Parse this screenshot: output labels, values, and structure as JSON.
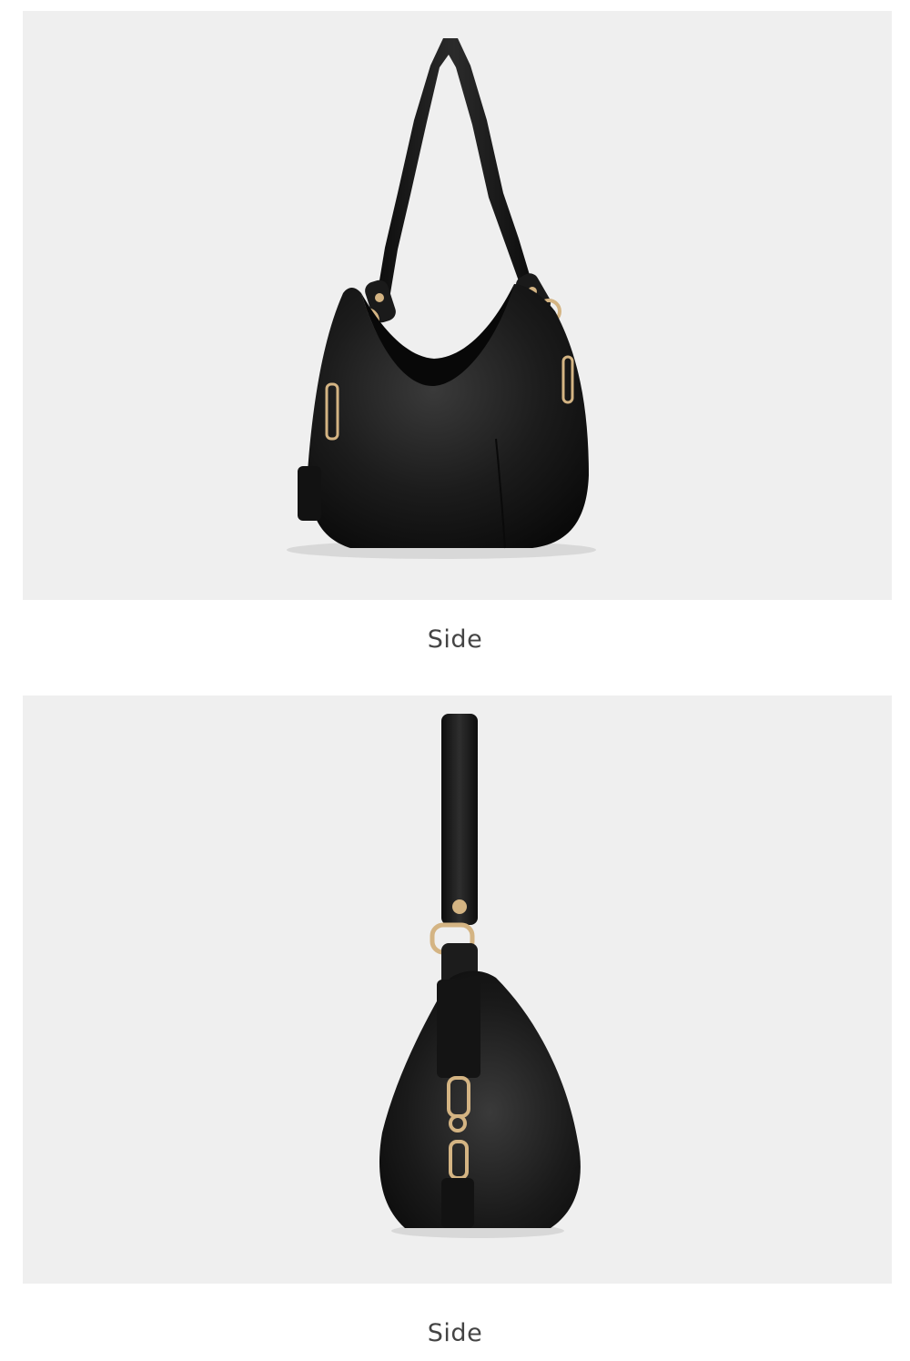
{
  "panels": [
    {
      "caption": "Side",
      "image": "black-leather-hobo-shoulder-bag-angled-view"
    },
    {
      "caption": "Side",
      "image": "black-leather-hobo-shoulder-bag-side-profile"
    }
  ],
  "colors": {
    "panel_background": "#efefef",
    "leather": "#161616",
    "hardware": "#d4b483",
    "caption_text": "#444444"
  }
}
